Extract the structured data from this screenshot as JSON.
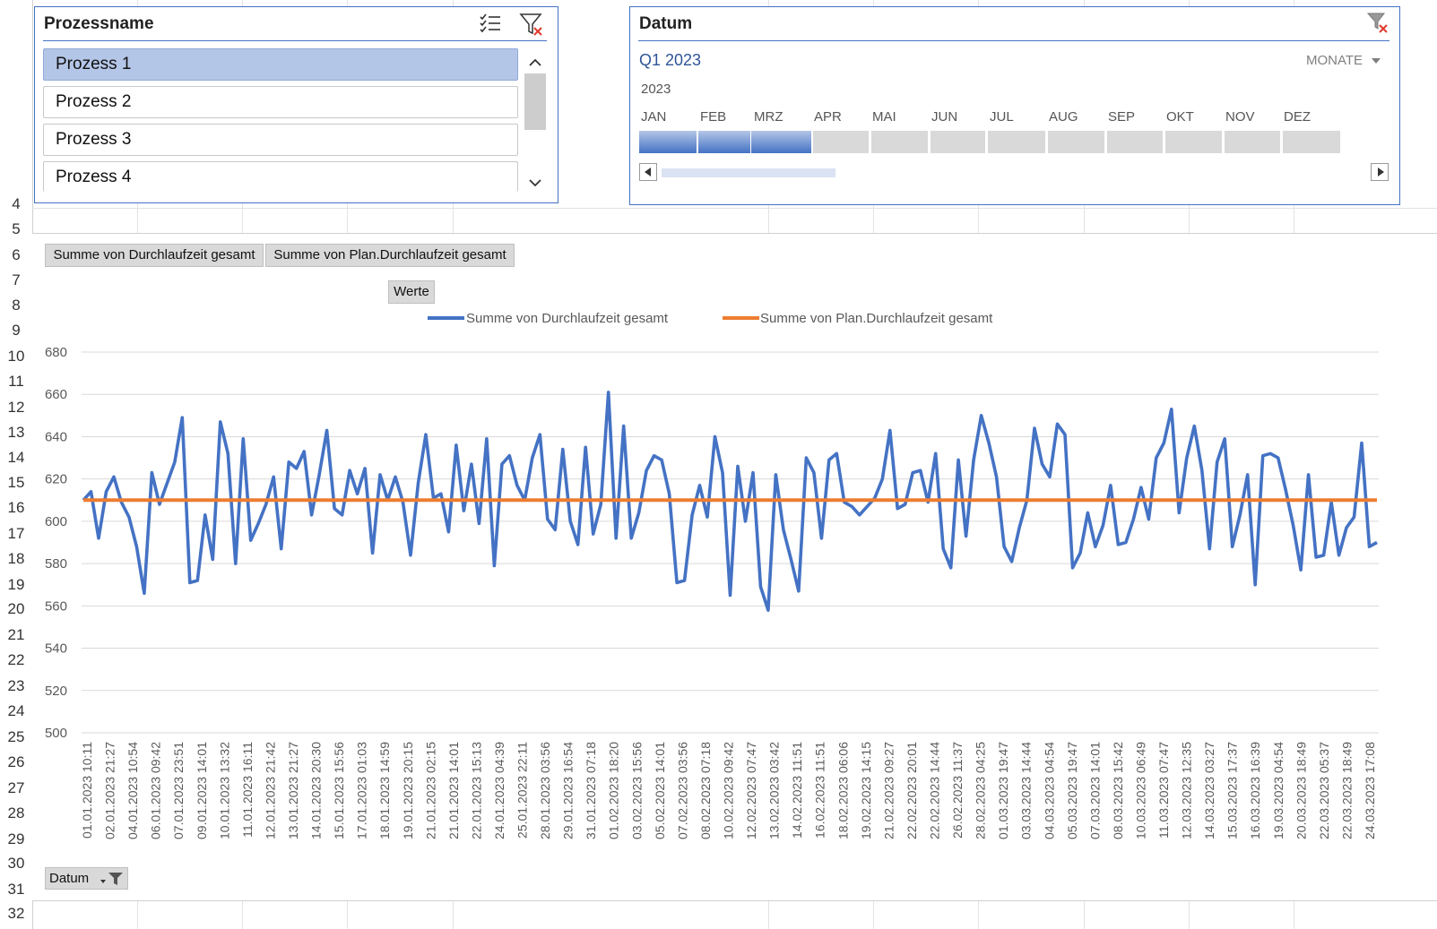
{
  "row_numbers": [
    "4",
    "5",
    "6",
    "7",
    "8",
    "9",
    "10",
    "11",
    "12",
    "13",
    "14",
    "15",
    "16",
    "17",
    "18",
    "19",
    "20",
    "21",
    "22",
    "23",
    "24",
    "25",
    "26",
    "27",
    "28",
    "29",
    "30",
    "31",
    "32"
  ],
  "process_slicer": {
    "title": "Prozessname",
    "items": [
      "Prozess 1",
      "Prozess 2",
      "Prozess 3",
      "Prozess 4"
    ],
    "selected_index": 0,
    "icons": [
      "multi-select-icon",
      "clear-filter-icon",
      "scroll-up-icon",
      "scroll-down-icon"
    ]
  },
  "date_slicer": {
    "title": "Datum",
    "range_label": "Q1 2023",
    "level_label": "MONATE",
    "year": "2023",
    "months": [
      "JAN",
      "FEB",
      "MRZ",
      "APR",
      "MAI",
      "JUN",
      "JUL",
      "AUG",
      "SEP",
      "OKT",
      "NOV",
      "DEZ"
    ],
    "selected_months": [
      0,
      1,
      2
    ]
  },
  "pivot_buttons": {
    "series1": "Summe von Durchlaufzeit gesamt",
    "series2": "Summe von Plan.Durchlaufzeit gesamt",
    "werte": "Werte",
    "datum": "Datum"
  },
  "colors": {
    "series1": "#4472c4",
    "series2": "#ed7d31",
    "accent": "#4472c4"
  },
  "chart_data": {
    "type": "line",
    "ylim": [
      500,
      680
    ],
    "yticks": [
      500,
      520,
      540,
      560,
      580,
      600,
      620,
      640,
      660,
      680
    ],
    "x_tick_labels": [
      "01.01.2023 10:11",
      "02.01.2023 21:27",
      "04.01.2023 10:54",
      "06.01.2023 09:42",
      "07.01.2023 23:51",
      "09.01.2023 14:01",
      "10.01.2023 13:32",
      "11.01.2023 16:11",
      "12.01.2023 21:42",
      "13.01.2023 21:27",
      "14.01.2023 20:30",
      "15.01.2023 15:56",
      "17.01.2023 01:03",
      "18.01.2023 14:59",
      "19.01.2023 20:15",
      "21.01.2023 02:15",
      "21.01.2023 14:01",
      "22.01.2023 15:13",
      "24.01.2023 04:39",
      "25.01.2023 22:11",
      "28.01.2023 03:56",
      "29.01.2023 16:54",
      "31.01.2023 07:18",
      "01.02.2023 18:20",
      "03.02.2023 15:56",
      "05.02.2023 14:01",
      "07.02.2023 03:56",
      "08.02.2023 07:18",
      "10.02.2023 09:42",
      "12.02.2023 07:47",
      "13.02.2023 03:42",
      "14.02.2023 11:51",
      "16.02.2023 11:51",
      "18.02.2023 06:06",
      "19.02.2023 14:15",
      "21.02.2023 09:27",
      "22.02.2023 20:01",
      "22.02.2023 14:44",
      "26.02.2023 11:37",
      "28.02.2023 04:25",
      "01.03.2023 19:47",
      "03.03.2023 14:44",
      "04.03.2023 04:54",
      "05.03.2023 19:47",
      "07.03.2023 14:01",
      "08.03.2023 15:42",
      "10.03.2023 06:49",
      "11.03.2023 07:47",
      "12.03.2023 12:35",
      "14.03.2023 03:27",
      "15.03.2023 17:37",
      "16.03.2023 16:39",
      "19.03.2023 04:54",
      "20.03.2023 18:49",
      "22.03.2023 05:37",
      "22.03.2023 18:49",
      "24.03.2023 17:08"
    ],
    "series": [
      {
        "name": "Summe von Durchlaufzeit gesamt",
        "values": [
          610,
          614,
          592,
          614,
          621,
          609,
          602,
          588,
          566,
          623,
          608,
          618,
          628,
          649,
          571,
          572,
          603,
          582,
          647,
          632,
          580,
          639,
          591,
          599,
          608,
          621,
          587,
          628,
          625,
          633,
          603,
          622,
          643,
          606,
          603,
          624,
          613,
          625,
          585,
          622,
          610,
          621,
          609,
          584,
          618,
          641,
          611,
          613,
          595,
          636,
          605,
          627,
          599,
          639,
          579,
          627,
          631,
          617,
          610,
          630,
          641,
          601,
          596,
          634,
          600,
          589,
          635,
          594,
          608,
          661,
          592,
          645,
          592,
          604,
          624,
          631,
          629,
          613,
          571,
          572,
          603,
          617,
          602,
          640,
          623,
          565,
          626,
          600,
          623,
          569,
          558,
          622,
          596,
          582,
          567,
          630,
          623,
          592,
          629,
          632,
          609,
          607,
          603,
          607,
          611,
          620,
          643,
          606,
          608,
          623,
          624,
          609,
          632,
          587,
          578,
          629,
          593,
          629,
          650,
          637,
          621,
          588,
          581,
          597,
          610,
          644,
          627,
          621,
          646,
          641,
          578,
          585,
          604,
          588,
          598,
          617,
          589,
          590,
          601,
          616,
          601,
          630,
          637,
          653,
          604,
          630,
          645,
          624,
          587,
          628,
          639,
          588,
          603,
          622,
          570,
          631,
          632,
          630,
          615,
          598,
          577,
          622,
          583,
          584,
          609,
          584,
          597,
          602,
          637,
          588,
          590
        ]
      },
      {
        "name": "Summe von Plan.Durchlaufzeit gesamt",
        "values": [
          610,
          610
        ]
      }
    ],
    "legend_position": "top",
    "grid": true
  }
}
